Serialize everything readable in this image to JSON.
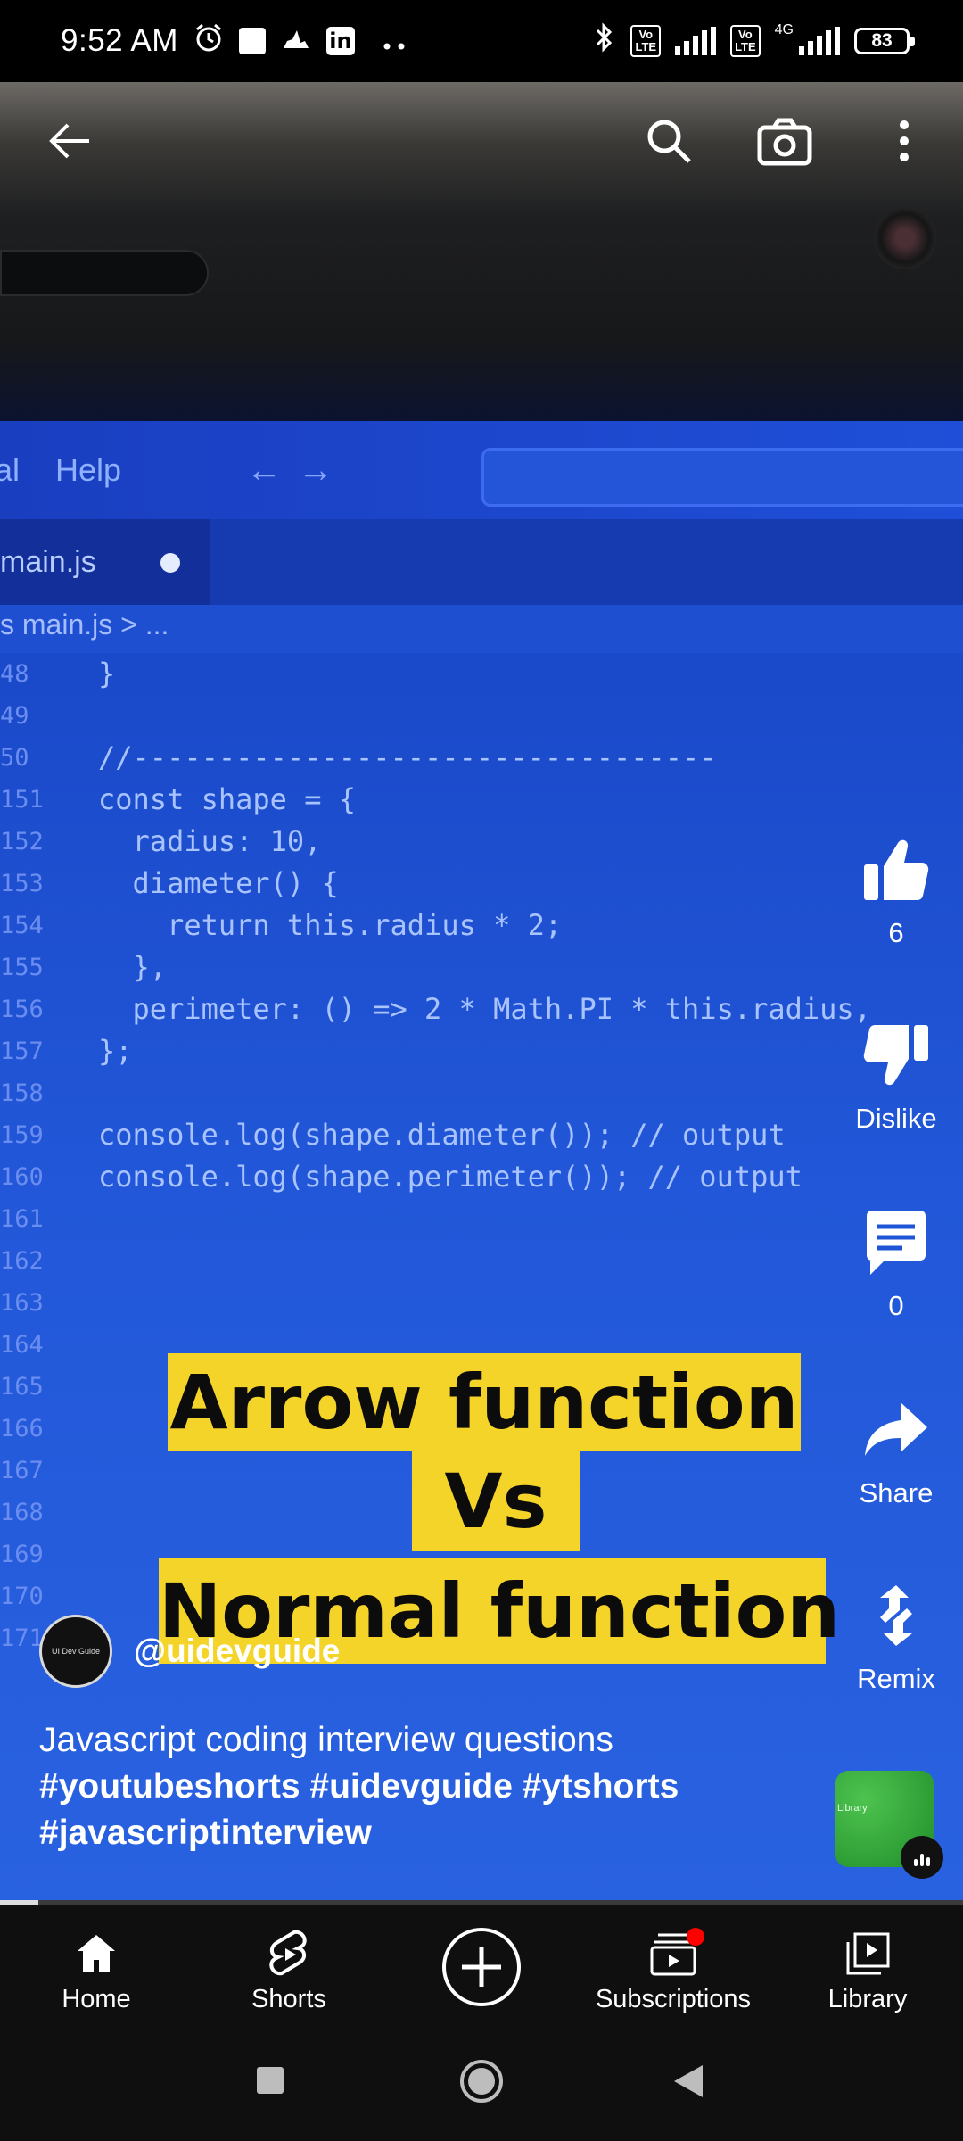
{
  "status_bar": {
    "time": "9:52 AM",
    "network": "4G",
    "battery": "83",
    "icons": [
      "alarm-icon",
      "notification-square-icon",
      "cloud-icon",
      "linkedin-icon",
      "more-dots-icon",
      "bluetooth-icon",
      "volte-icon",
      "signal-icon"
    ]
  },
  "topbar": {
    "icons": [
      "back-arrow-icon",
      "search-icon",
      "camera-icon",
      "more-vert-icon"
    ]
  },
  "video": {
    "editor_menu": [
      "al",
      "Help"
    ],
    "tab_name": "main.js",
    "breadcrumb": "s main.js > ...",
    "line_numbers": [
      "48",
      "49",
      "50",
      "151",
      "152",
      "153",
      "154",
      "155",
      "156",
      "157",
      "158",
      "159",
      "160",
      "161",
      "162",
      "163",
      "164",
      "165",
      "166",
      "167",
      "168",
      "169",
      "170",
      "171"
    ],
    "code_lines": [
      "}",
      "",
      "//----------------------------------",
      "const shape = {",
      "  radius: 10,",
      "  diameter() {",
      "    return this.radius * 2;",
      "  },",
      "  perimeter: () => 2 * Math.PI * this.radius,",
      "};",
      "",
      "console.log(shape.diameter()); // output",
      "console.log(shape.perimeter()); // output"
    ],
    "title_line1": "Arrow function",
    "title_line2": "Vs",
    "title_line3": "Normal function"
  },
  "rail": {
    "like_count": "6",
    "dislike_label": "Dislike",
    "comment_count": "0",
    "share_label": "Share",
    "remix_label": "Remix"
  },
  "channel": {
    "avatar_text": "UI Dev Guide",
    "handle": "@uidevguide"
  },
  "description": {
    "text": "Javascript coding interview questions",
    "tags_line1": "#youtubeshorts #uidevguide #ytshorts",
    "tags_line2": "#javascriptinterview"
  },
  "remix_thumbnail": {
    "text": "Library"
  },
  "progress": {
    "fraction": 0.04
  },
  "bottom_nav": {
    "home": "Home",
    "shorts": "Shorts",
    "subscriptions": "Subscriptions",
    "library": "Library"
  },
  "colors": {
    "title_bg": "#f5d42a",
    "video_blue": "#1d4fd0",
    "nav_bg": "#0f0f0f",
    "badge_red": "#ff0000"
  }
}
